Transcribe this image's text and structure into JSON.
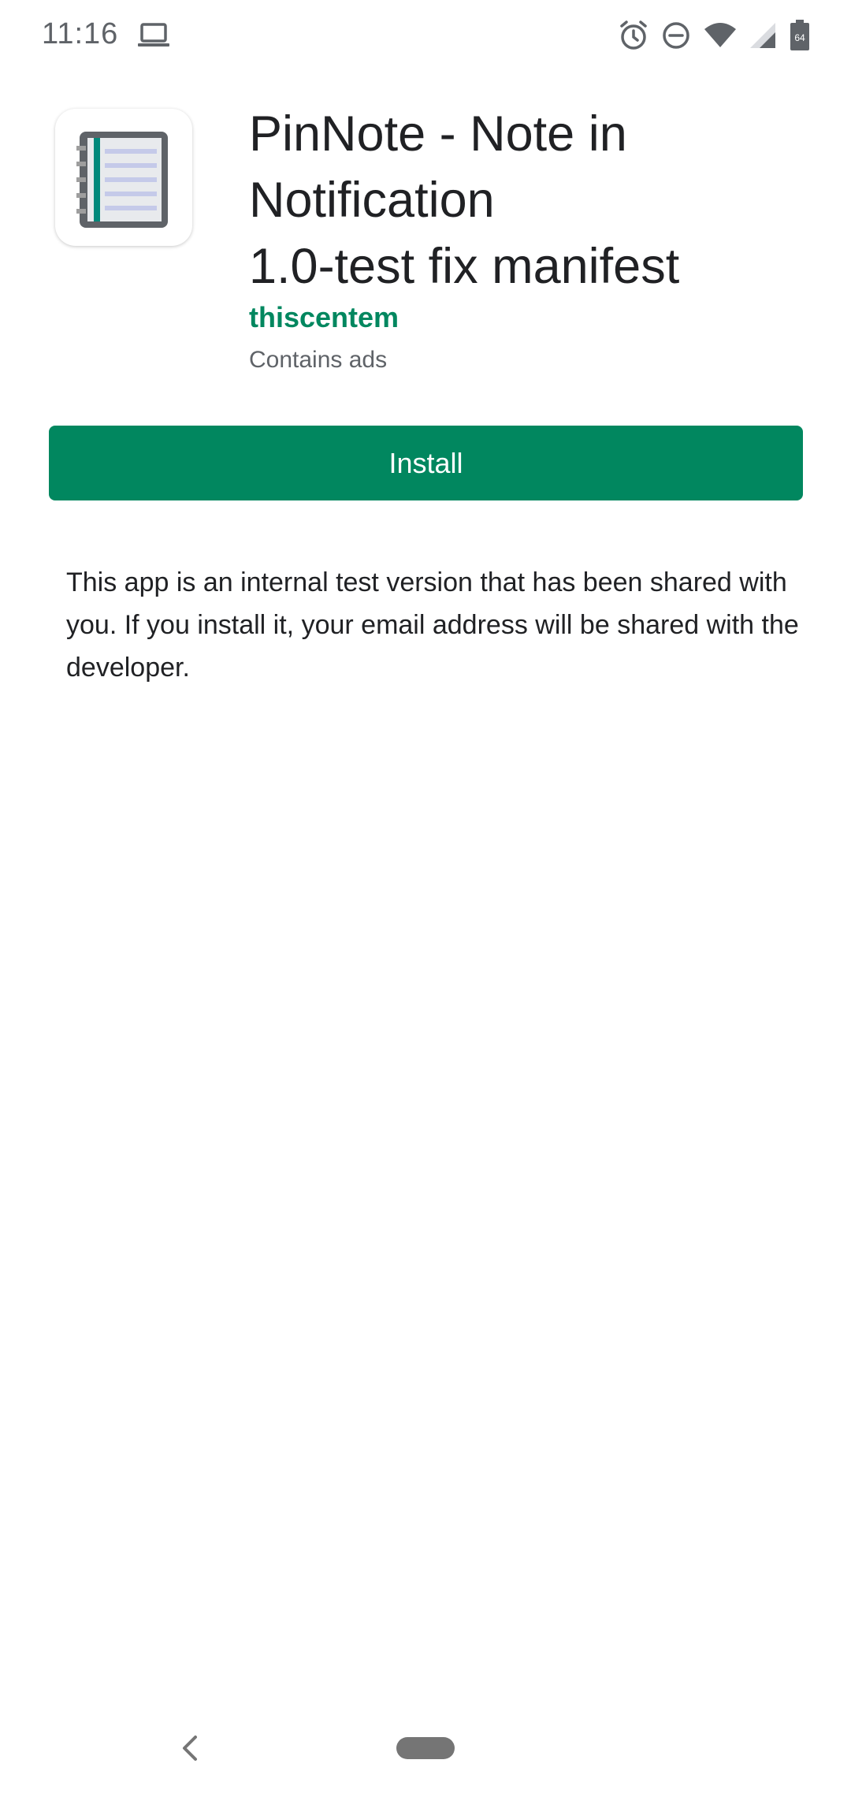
{
  "status_bar": {
    "time": "11:16",
    "icons": [
      "laptop-icon",
      "alarm-icon",
      "do-not-disturb-icon",
      "wifi-icon",
      "signal-icon",
      "battery-icon"
    ],
    "battery_level": "64"
  },
  "app": {
    "icon": "notebook-icon",
    "title_lines": [
      "PinNote - Note in",
      "Notification",
      "1.0-test fix manifest"
    ],
    "developer": "thiscentem",
    "ads_note": "Contains ads"
  },
  "install_button": {
    "label": "Install"
  },
  "notice": {
    "text": "This app is an internal test version that has been shared with you. If you install it, your email address will be shared with the developer."
  },
  "nav_bar": {
    "icons": [
      "back-icon",
      "home-pill"
    ]
  },
  "colors": {
    "accent": "#01875f",
    "text_primary": "#202124",
    "text_secondary": "#5f6368",
    "background": "#ffffff"
  }
}
